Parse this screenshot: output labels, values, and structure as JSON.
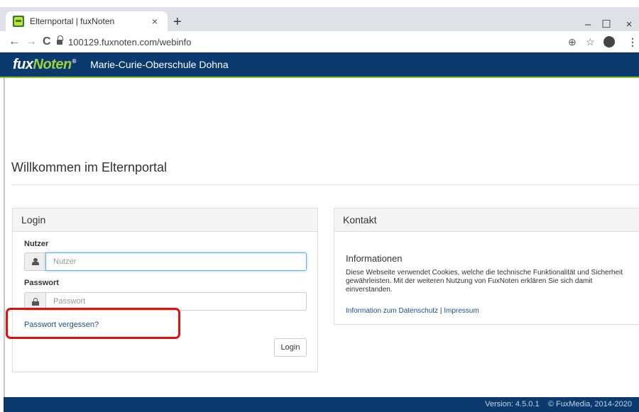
{
  "browser": {
    "tab_title": "Elternportal | fuxNoten",
    "tab_close": "×",
    "new_tab": "+",
    "url": "100129.fuxnoten.com/webinfo",
    "minimize": "–",
    "maximize": "☐",
    "close": "×",
    "back": "←",
    "forward": "→",
    "reload": "C",
    "zoom_icon": "⊕",
    "star_icon": "☆",
    "menu_icon": "⋮"
  },
  "header": {
    "logo_fux": "fux",
    "logo_noten": "Noten",
    "logo_reg": "®",
    "school_name": "Marie-Curie-Oberschule Dohna"
  },
  "page": {
    "title": "Willkommen im Elternportal"
  },
  "login": {
    "heading": "Login",
    "user_label": "Nutzer",
    "user_placeholder": "Nutzer",
    "password_label": "Passwort",
    "password_placeholder": "Passwort",
    "forgot_link": "Passwort vergessen?",
    "button": "Login"
  },
  "contact": {
    "heading": "Kontakt",
    "info_title": "Informationen",
    "info_text": "Diese Webseite verwendet Cookies, welche die technische Funktionalität und Sicherheit gewährleisten. Mit der weiteren Nutzung von FuxNoten erklären Sie sich damit einverstanden.",
    "privacy_link": "Information zum Datenschutz",
    "separator": " | ",
    "imprint_link": "Impressum"
  },
  "footer": {
    "version": "Version: 4.5.0.1",
    "copyright": "© FuxMedia, 2014-2020"
  },
  "colors": {
    "brand_blue": "#0b3a6e",
    "brand_green": "#9fd13a",
    "highlight_red": "#e01010"
  }
}
